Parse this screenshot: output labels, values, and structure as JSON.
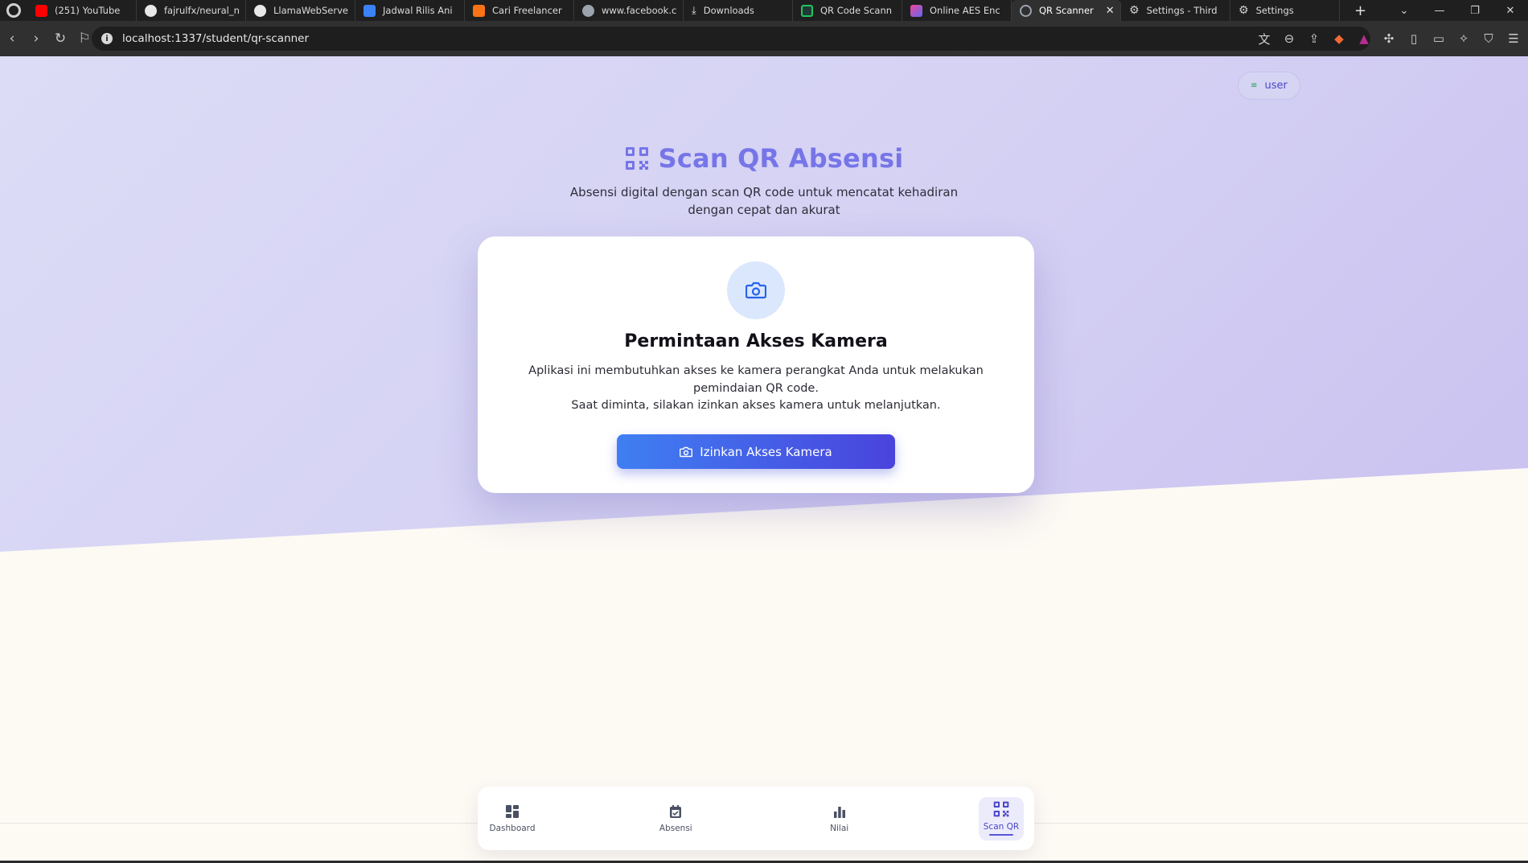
{
  "browser": {
    "tabs": [
      {
        "label": "(251) YouTube",
        "favicon": "youtube-icon",
        "color": "#ff0000"
      },
      {
        "label": "fajrulfx/neural_n",
        "favicon": "github-icon",
        "color": "#e8e8e8"
      },
      {
        "label": "LlamaWebServe",
        "favicon": "github-icon",
        "color": "#e8e8e8"
      },
      {
        "label": "Jadwal Rilis Ani",
        "favicon": "bookmark-icon",
        "color": "#3b82f6"
      },
      {
        "label": "Cari Freelancer",
        "favicon": "freelancer-icon",
        "color": "#f97316"
      },
      {
        "label": "www.facebook.c",
        "favicon": "facebook-icon",
        "color": "#9ca3af"
      },
      {
        "label": "Downloads",
        "favicon": "download-icon",
        "color": "#e8e8e8"
      },
      {
        "label": "QR Code Scann",
        "favicon": "qr-icon",
        "color": "#22c55e"
      },
      {
        "label": "Online AES Enc",
        "favicon": "aes-icon",
        "color": "#ec4899"
      },
      {
        "label": "QR Scanner",
        "favicon": "globe-icon",
        "color": "#9ca3af",
        "active": true
      },
      {
        "label": "Settings - Third",
        "favicon": "gear-icon",
        "color": "#d0d0d0"
      },
      {
        "label": "Settings",
        "favicon": "gear-icon",
        "color": "#d0d0d0"
      }
    ],
    "url": "localhost:1337/student/qr-scanner",
    "close_glyph": "✕",
    "new_tab_glyph": "+"
  },
  "header": {
    "user_label": "user",
    "title": "Scan QR Absensi",
    "subtitle_line1": "Absensi digital dengan scan QR code untuk mencatat kehadiran",
    "subtitle_line2": "dengan cepat dan akurat"
  },
  "card": {
    "title": "Permintaan Akses Kamera",
    "desc_line1": "Aplikasi ini membutuhkan akses ke kamera perangkat Anda untuk melakukan",
    "desc_line2": "pemindaian QR code.",
    "desc_line3": "Saat diminta, silakan izinkan akses kamera untuk melanjutkan.",
    "button_label": "Izinkan Akses Kamera"
  },
  "bottom_nav": [
    {
      "label": "Dashboard",
      "icon": "dashboard-icon"
    },
    {
      "label": "Absensi",
      "icon": "calendar-check-icon"
    },
    {
      "label": "Nilai",
      "icon": "bar-chart-icon"
    },
    {
      "label": "Scan QR",
      "icon": "qr-scan-icon",
      "active": true
    }
  ],
  "colors": {
    "accent": "#4a46c8",
    "title": "#7675e8",
    "button_start": "#3f7ff2",
    "button_end": "#4a43dd",
    "hero_bg": "#d4d0f3"
  }
}
